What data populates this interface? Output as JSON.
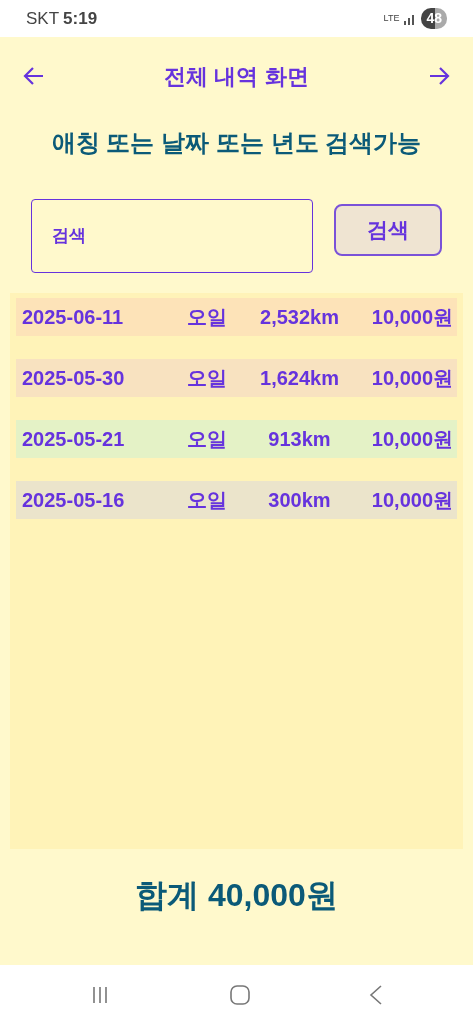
{
  "status_bar": {
    "carrier": "SKT",
    "time": "5:19",
    "network": "LTE",
    "battery": "48"
  },
  "header": {
    "title": "전체 내역 화면"
  },
  "subtitle": "애칭 또는 날짜 또는 년도 검색가능",
  "search": {
    "placeholder": "검색",
    "button": "검색"
  },
  "records": [
    {
      "date": "2025-06-11",
      "name": "오일",
      "distance": "2,532km",
      "amount": "10,000원",
      "color": "#fde3b8"
    },
    {
      "date": "2025-05-30",
      "name": "오일",
      "distance": "1,624km",
      "amount": "10,000원",
      "color": "#f8e2c0"
    },
    {
      "date": "2025-05-21",
      "name": "오일",
      "distance": "913km",
      "amount": "10,000원",
      "color": "#e4f2c6"
    },
    {
      "date": "2025-05-16",
      "name": "오일",
      "distance": "300km",
      "amount": "10,000원",
      "color": "#ebe4cb"
    }
  ],
  "total": "합계 40,000원"
}
